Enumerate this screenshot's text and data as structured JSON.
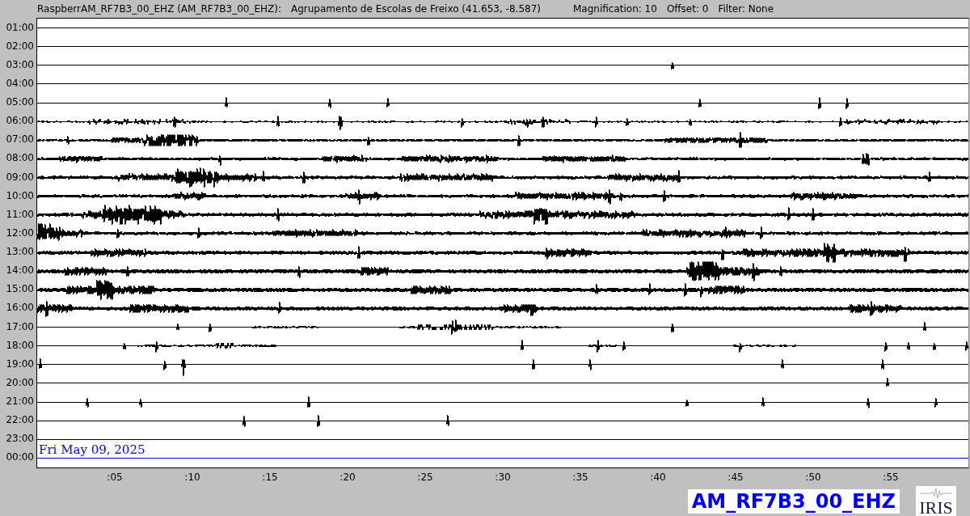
{
  "header": {
    "station": "RaspberrAM_RF7B3_00_EHZ (AM_RF7B3_00_EHZ):",
    "location": "Agrupamento de Escolas de Freixo (41.653, -8.587)",
    "magnification": "Magnification: 10",
    "offset": "Offset: 0",
    "filter": "Filter: None"
  },
  "rows": [
    {
      "time": "01:00",
      "kind": "trace"
    },
    {
      "time": "02:00",
      "kind": "trace"
    },
    {
      "time": "03:00",
      "kind": "trace"
    },
    {
      "time": "04:00",
      "kind": "trace"
    },
    {
      "time": "05:00",
      "kind": "trace"
    },
    {
      "time": "06:00",
      "kind": "trace"
    },
    {
      "time": "07:00",
      "kind": "trace"
    },
    {
      "time": "08:00",
      "kind": "trace"
    },
    {
      "time": "09:00",
      "kind": "trace"
    },
    {
      "time": "10:00",
      "kind": "trace"
    },
    {
      "time": "11:00",
      "kind": "trace"
    },
    {
      "time": "12:00",
      "kind": "trace"
    },
    {
      "time": "13:00",
      "kind": "trace"
    },
    {
      "time": "14:00",
      "kind": "trace"
    },
    {
      "time": "15:00",
      "kind": "trace"
    },
    {
      "time": "16:00",
      "kind": "trace"
    },
    {
      "time": "17:00",
      "kind": "trace"
    },
    {
      "time": "18:00",
      "kind": "trace"
    },
    {
      "time": "19:00",
      "kind": "trace"
    },
    {
      "time": "20:00",
      "kind": "trace"
    },
    {
      "time": "21:00",
      "kind": "trace"
    },
    {
      "time": "22:00",
      "kind": "trace"
    },
    {
      "time": "23:00",
      "kind": "trace"
    },
    {
      "time": "00:00",
      "kind": "current"
    }
  ],
  "date": "Fri May 09, 2025",
  "x_axis": [
    ":05",
    ":10",
    ":15",
    ":20",
    ":25",
    ":30",
    ":35",
    ":40",
    ":45",
    ":50",
    ":55"
  ],
  "station_label": "AM_RF7B3_00_EHZ",
  "logo": "IRIS"
}
